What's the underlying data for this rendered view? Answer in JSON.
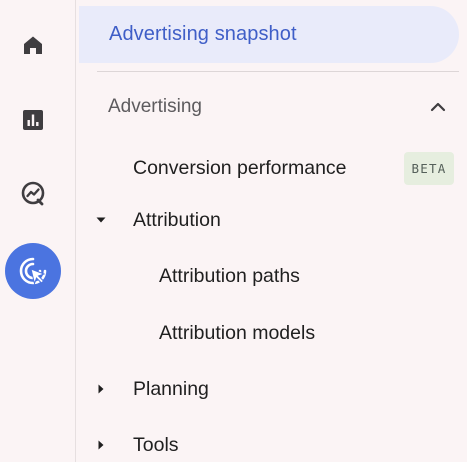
{
  "rail": {
    "items": [
      {
        "icon": "home-icon"
      },
      {
        "icon": "reports-icon"
      },
      {
        "icon": "explore-icon"
      },
      {
        "icon": "advertising-icon",
        "active": true
      }
    ],
    "active_color": "#4b74e0"
  },
  "nav": {
    "snapshot_label": "Advertising snapshot",
    "section_label": "Advertising",
    "conversion_label": "Conversion performance",
    "beta_label": "BETA",
    "attribution_label": "Attribution",
    "attribution_paths_label": "Attribution paths",
    "attribution_models_label": "Attribution models",
    "planning_label": "Planning",
    "tools_label": "Tools"
  }
}
